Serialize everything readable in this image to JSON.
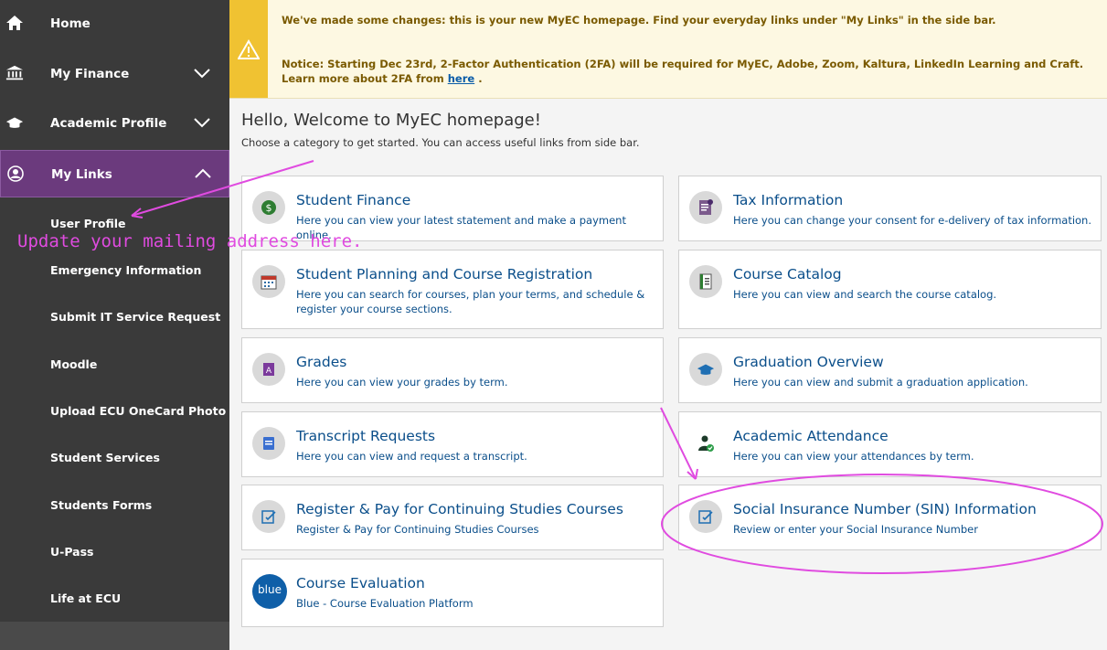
{
  "sidebar": {
    "items": [
      {
        "label": "Home",
        "icon": "home-icon"
      },
      {
        "label": "My Finance",
        "icon": "bank-icon"
      },
      {
        "label": "Academic Profile",
        "icon": "graduation-cap-icon"
      },
      {
        "label": "My Links",
        "icon": "user-circle-icon"
      }
    ],
    "sublinks": [
      "User Profile",
      "Emergency Information",
      "Submit IT Service Request",
      "Moodle",
      "Upload ECU OneCard Photo",
      "Student Services",
      "Students Forms",
      "U-Pass",
      "Life at ECU"
    ]
  },
  "notice": {
    "line1": "We've made some changes: this is your new MyEC homepage. Find your everyday links under \"My Links\" in the side bar.",
    "line2": "Notice: Starting Dec 23rd, 2-Factor Authentication (2FA) will be required for MyEC, Adobe, Zoom, Kaltura, LinkedIn Learning and Craft. Learn more about 2FA from",
    "link": "here",
    "after_link": " ."
  },
  "welcome": {
    "title": "Hello, Welcome to MyEC homepage!",
    "subtitle": "Choose a category to get started. You can access useful links from side bar."
  },
  "cards": [
    {
      "title": "Student Finance",
      "desc": "Here you can view your latest statement and make a payment online.",
      "icon": "dollar-icon"
    },
    {
      "title": "Tax Information",
      "desc": "Here you can change your consent for e-delivery of tax information.",
      "icon": "tax-document-icon"
    },
    {
      "title": "Student Planning and Course Registration",
      "desc": "Here you can search for courses, plan your terms, and schedule & register your course sections.",
      "icon": "calendar-icon"
    },
    {
      "title": "Course Catalog",
      "desc": "Here you can view and search the course catalog.",
      "icon": "catalog-book-icon"
    },
    {
      "title": "Grades",
      "desc": "Here you can view your grades by term.",
      "icon": "grades-icon"
    },
    {
      "title": "Graduation Overview",
      "desc": "Here you can view and submit a graduation application.",
      "icon": "graduation-cap-icon"
    },
    {
      "title": "Transcript Requests",
      "desc": "Here you can view and request a transcript.",
      "icon": "transcript-icon"
    },
    {
      "title": "Academic Attendance",
      "desc": "Here you can view your attendances by term.",
      "icon": "attendance-user-icon"
    },
    {
      "title": "Register & Pay for Continuing Studies Courses",
      "desc": "Register & Pay for Continuing Studies Courses",
      "icon": "edit-form-icon"
    },
    {
      "title": "Social Insurance Number (SIN) Information",
      "desc": "Review or enter your Social Insurance Number",
      "icon": "edit-form-icon"
    },
    {
      "title": "Course Evaluation",
      "desc": "Blue - Course Evaluation Platform",
      "icon": "blue-logo-icon",
      "logo_text": "blue"
    }
  ],
  "annotation": {
    "text": "Update your mailing address here.",
    "color": "#e04be0"
  },
  "colors": {
    "sidebar_bg": "#3a3a3a",
    "active_item": "#6b3a7d",
    "notice_stripe": "#f0c232",
    "link_blue": "#0a4e8a"
  }
}
